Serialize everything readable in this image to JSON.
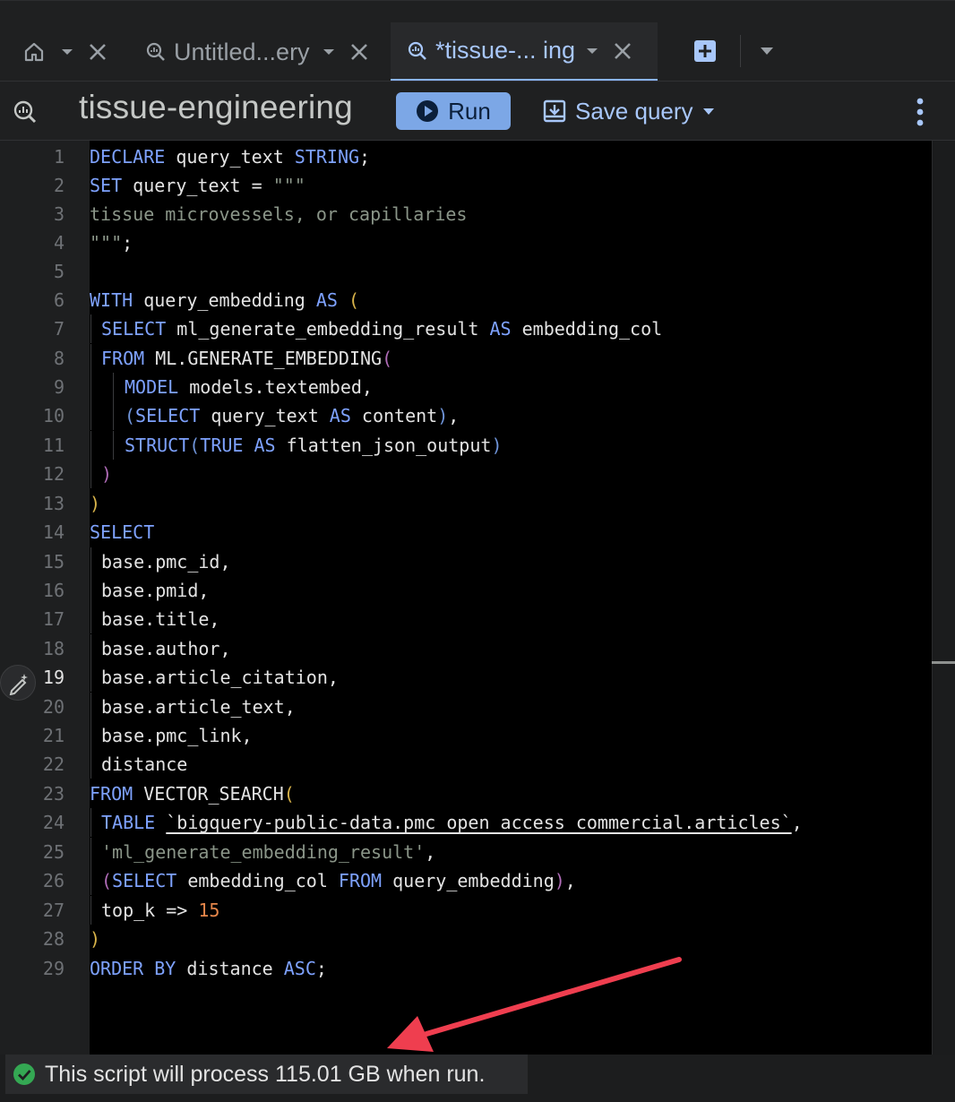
{
  "tabs": [
    {
      "label": "",
      "icon": "home-icon",
      "active": false
    },
    {
      "label": "Untitled...ery",
      "icon": "query-icon",
      "active": false
    },
    {
      "label": "*tissue-...  ing",
      "icon": "query-icon",
      "active": true
    }
  ],
  "toolbar": {
    "title": "tissue-engineering",
    "run_label": "Run",
    "save_label": "Save query"
  },
  "editor": {
    "current_line": 19,
    "lines": [
      {
        "n": "1"
      },
      {
        "n": "2"
      },
      {
        "n": "3"
      },
      {
        "n": "4"
      },
      {
        "n": "5"
      },
      {
        "n": "6"
      },
      {
        "n": "7"
      },
      {
        "n": "8"
      },
      {
        "n": "9"
      },
      {
        "n": "10"
      },
      {
        "n": "11"
      },
      {
        "n": "12"
      },
      {
        "n": "13"
      },
      {
        "n": "14"
      },
      {
        "n": "15"
      },
      {
        "n": "16"
      },
      {
        "n": "17"
      },
      {
        "n": "18"
      },
      {
        "n": "19"
      },
      {
        "n": "20"
      },
      {
        "n": "21"
      },
      {
        "n": "22"
      },
      {
        "n": "23"
      },
      {
        "n": "24"
      },
      {
        "n": "25"
      },
      {
        "n": "26"
      },
      {
        "n": "27"
      },
      {
        "n": "28"
      },
      {
        "n": "29"
      }
    ],
    "tokens": {
      "l1": [
        "DECLARE",
        " query_text ",
        "STRING",
        ";"
      ],
      "l2": [
        "SET",
        " query_text = ",
        "\"\"\""
      ],
      "l3": [
        "tissue microvessels, or capillaries"
      ],
      "l4": [
        "\"\"\"",
        ";"
      ],
      "l6": [
        "WITH",
        " query_embedding ",
        "AS",
        " ",
        "("
      ],
      "l7": [
        "SELECT",
        " ml_generate_embedding_result ",
        "AS",
        " embedding_col"
      ],
      "l8": [
        "FROM",
        " ML.GENERATE_EMBEDDING",
        "("
      ],
      "l9": [
        "MODEL",
        " models.textembed,"
      ],
      "l10": [
        "(",
        "SELECT",
        " query_text ",
        "AS",
        " content",
        ")",
        ","
      ],
      "l11": [
        "STRUCT",
        "(",
        "TRUE",
        " ",
        "AS",
        " flatten_json_output",
        ")"
      ],
      "l12": [
        ")"
      ],
      "l13": [
        ")"
      ],
      "l14": [
        "SELECT"
      ],
      "l15": [
        "base.pmc_id,"
      ],
      "l16": [
        "base.pmid,"
      ],
      "l17": [
        "base.title,"
      ],
      "l18": [
        "base.author,"
      ],
      "l19": [
        "base.article_citation,"
      ],
      "l20": [
        "base.article_text,"
      ],
      "l21": [
        "base.pmc_link,"
      ],
      "l22": [
        "distance"
      ],
      "l23": [
        "FROM",
        " VECTOR_SEARCH",
        "("
      ],
      "l24": [
        "TABLE",
        " ",
        "`bigquery-public-data.pmc_open_access_commercial.articles`",
        ","
      ],
      "l25": [
        "'ml_generate_embedding_result'",
        ","
      ],
      "l26": [
        "(",
        "SELECT",
        " embedding_col ",
        "FROM",
        " query_embedding",
        ")",
        ","
      ],
      "l27": [
        "top_k => ",
        "15"
      ],
      "l28": [
        ")"
      ],
      "l29": [
        "ORDER BY",
        " distance ",
        "ASC",
        ";"
      ]
    }
  },
  "status": {
    "message": "This script will process 115.01 GB when run.",
    "icon": "check-circle-icon",
    "color": "#34a853"
  },
  "colors": {
    "accent": "#a8c7fa",
    "run_button": "#7ca7e6",
    "annotation_arrow": "#ef3e4f"
  }
}
